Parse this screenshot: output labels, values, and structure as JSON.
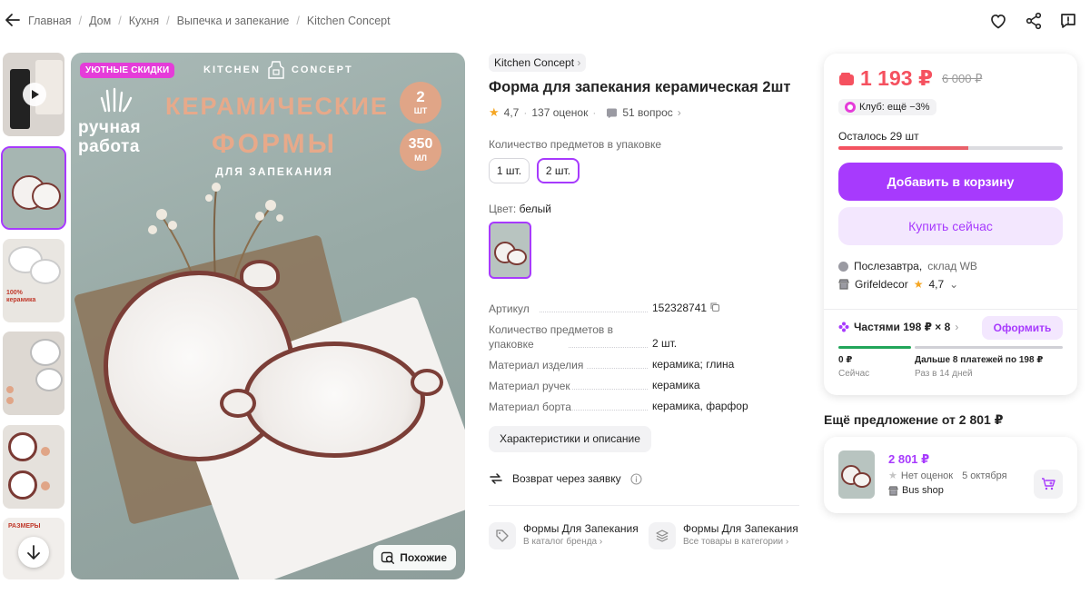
{
  "breadcrumbs": [
    "Главная",
    "Дом",
    "Кухня",
    "Выпечка и запекание",
    "Kitchen Concept"
  ],
  "gallery": {
    "main_badge": "УЮТНЫЕ СКИДКИ",
    "logo_text_left": "KITCHEN",
    "logo_text_right": "CONCEPT",
    "hand_text_1": "ручная",
    "hand_text_2": "работа",
    "headline_1": "КЕРАМИЧЕСКИЕ",
    "headline_2": "ФОРМЫ",
    "headline_3": "ДЛЯ ЗАПЕКАНИЯ",
    "circle_1_value": "2",
    "circle_1_unit": "ШТ",
    "circle_2_value": "350",
    "circle_2_unit": "МЛ",
    "similar_label": "Похожие",
    "thumb_3_text": "100% керамика",
    "thumb_last_text": "РАЗМЕРЫ"
  },
  "product": {
    "brand": "Kitchen Concept",
    "title": "Форма для запекания керамическая 2шт",
    "rating": "4,7",
    "reviews": "137 оценок",
    "questions": "51 вопрос",
    "qty_label": "Количество предметов в упаковке",
    "qty_options": [
      "1 шт.",
      "2 шт."
    ],
    "color_label": "Цвет:",
    "color_value": "белый",
    "specs": [
      {
        "k": "Артикул",
        "v": "152328741"
      },
      {
        "k": "Количество предметов в упаковке",
        "v": "2 шт."
      },
      {
        "k": "Материал изделия",
        "v": "керамика; глина"
      },
      {
        "k": "Материал ручек",
        "v": "керамика"
      },
      {
        "k": "Материал борта",
        "v": "керамика, фарфор"
      }
    ],
    "specs_button": "Характеристики и описание",
    "return_text": "Возврат через заявку",
    "brand_link_title": "Формы Для Запекания",
    "brand_link_sub": "В каталог бренда",
    "cat_link_title": "Формы Для Запекания",
    "cat_link_sub": "Все товары в категории"
  },
  "buy": {
    "price": "1 193 ₽",
    "old_price": "6 000 ₽",
    "club": "Клуб: ещё −3%",
    "remaining": "Осталось 29 шт",
    "remaining_fraction": 0.58,
    "add_to_cart": "Добавить в корзину",
    "buy_now": "Купить сейчас",
    "delivery_1": "Послезавтра,",
    "delivery_2": "склад WB",
    "seller": "Grifeldecor",
    "seller_rating": "4,7",
    "installments": "Частями 198 ₽ × 8",
    "installments_button": "Оформить",
    "pay_now_amount": "0 ₽",
    "pay_now_label": "Сейчас",
    "pay_later_amount": "Дальше 8 платежей по 198 ₽",
    "pay_later_label": "Раз в 14 дней"
  },
  "other_offer": {
    "heading": "Ещё предложение от 2 801 ₽",
    "price": "2 801 ₽",
    "no_ratings": "Нет оценок",
    "date": "5 октября",
    "shop": "Bus shop"
  },
  "colors": {
    "accent": "#a73afd",
    "price": "#f5515f",
    "badge": "#e53cd9"
  }
}
